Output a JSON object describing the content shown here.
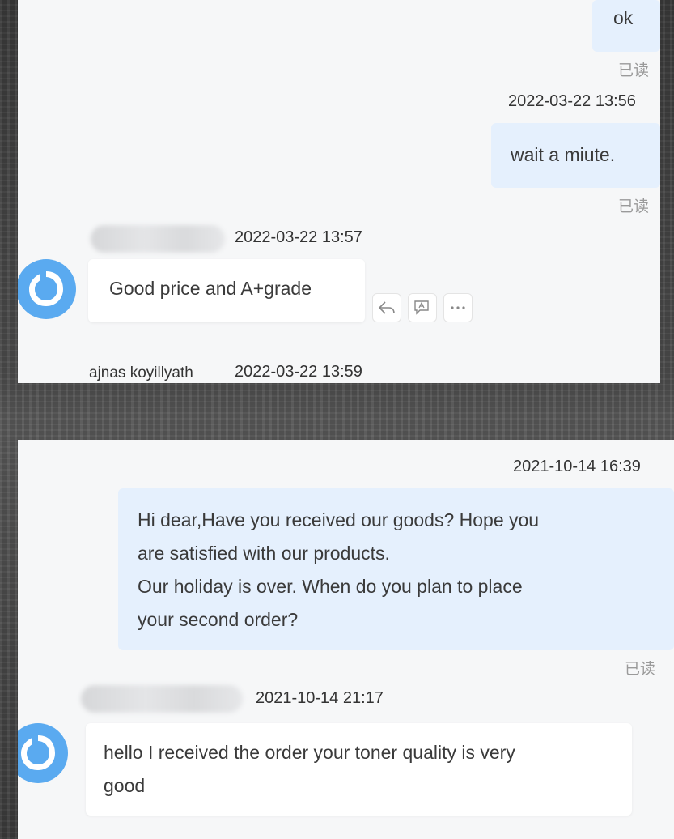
{
  "top": {
    "messages": [
      {
        "text": "ok",
        "status": "已读"
      },
      {
        "time": "2022-03-22 13:56",
        "text": "wait a miute.",
        "status": "已读"
      }
    ],
    "incoming": {
      "time": "2022-03-22 13:57",
      "text": "Good price and A+grade"
    },
    "next_sender": {
      "name": "ajnas koyillyath",
      "time": "2022-03-22 13:59"
    }
  },
  "bottom": {
    "outgoing": {
      "time": "2021-10-14 16:39",
      "lines": [
        "Hi dear,Have you received our goods? Hope you",
        "are satisfied with our products.",
        "Our holiday is over. When do you plan to place",
        "your second order?"
      ],
      "status": "已读"
    },
    "incoming": {
      "time": "2021-10-14 21:17",
      "lines": [
        "hello I received the order your toner quality is very",
        "good"
      ]
    }
  },
  "icons": [
    "reply-icon",
    "translate-icon",
    "more-icon",
    "avatar-icon"
  ],
  "colors": {
    "outgoing_bubble": "#e5f0fd",
    "incoming_bubble": "#ffffff",
    "avatar_blue": "#5aaaf0"
  }
}
